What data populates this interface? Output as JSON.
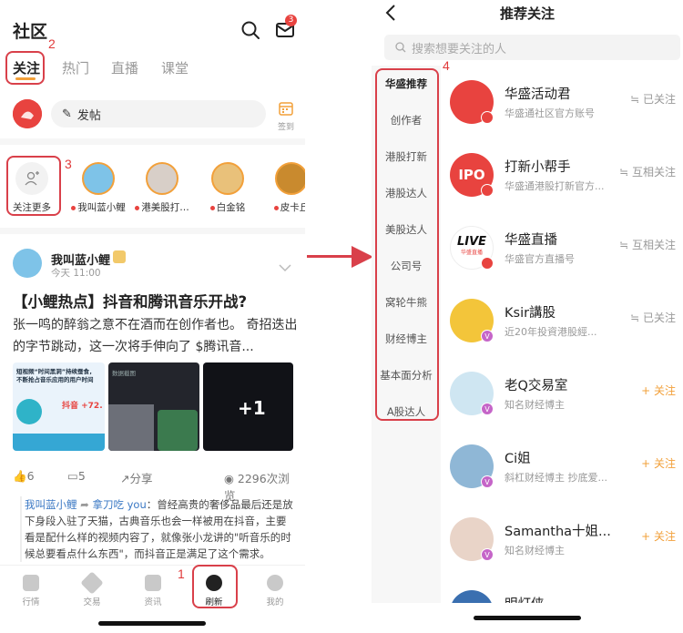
{
  "left": {
    "title": "社区",
    "mail_badge": "3",
    "tabs": [
      "关注",
      "热门",
      "直播",
      "课堂"
    ],
    "post_label": "发帖",
    "checkin_label": "签到",
    "follow_more": "关注更多",
    "followings": [
      {
        "name": "我叫蓝小鲤"
      },
      {
        "name": "港美股打…"
      },
      {
        "name": "白金铭"
      },
      {
        "name": "皮卡丘"
      }
    ],
    "post": {
      "author": "我叫蓝小鲤",
      "time": "今天 11:00",
      "headline": "【小鲤热点】抖音和腾讯音乐开战?",
      "excerpt": "张一鸣的醉翁之意不在酒而在创作者也。 奇招迭出的字节跳动，这一次将手伸向了 $腾讯音...",
      "images": [
        "短视频“时间黑洞”持续蚕食，不断抢占音乐应用的用户时间",
        "抖音 +72.",
        "数据截图",
        "+1"
      ],
      "likes": "6",
      "comments": "5",
      "share": "分享",
      "views": "2296次浏览",
      "comment_from": "我叫蓝小鲤",
      "comment_to": "拿刀吃 you",
      "comment_text": "：曾经高贵的奢侈品最后还是放下身段入驻了天猫，古典音乐也会一样被用在抖音，主要看是配什么样的视频内容了，就像张小龙讲的\"听音乐的时候总要看点什么东西\"，而抖音正是满足了这个需求。"
    },
    "nav": [
      "行情",
      "交易",
      "资讯",
      "刷新",
      "我的"
    ]
  },
  "annotations": [
    "1",
    "2",
    "3",
    "4"
  ],
  "right": {
    "title": "推荐关注",
    "search_placeholder": "搜索想要关注的人",
    "categories": [
      "华盛推荐",
      "创作者",
      "港股打新",
      "港股达人",
      "美股达人",
      "公司号",
      "窝轮牛熊",
      "财经博主",
      "基本面分析",
      "A股达人"
    ],
    "recs": [
      {
        "name": "华盛活动君",
        "desc": "华盛通社区官方账号",
        "btn": "≒ 已关注",
        "state": "followed"
      },
      {
        "name": "打新小帮手",
        "desc": "华盛通港股打新官方...",
        "btn": "≒ 互相关注",
        "state": "followed"
      },
      {
        "name": "华盛直播",
        "desc": "华盛官方直播号",
        "btn": "≒ 互相关注",
        "state": "followed"
      },
      {
        "name": "Ksir講股",
        "desc": "近20年投資港股經...",
        "btn": "≒ 已关注",
        "state": "followed"
      },
      {
        "name": "老Q交易室",
        "desc": "知名财经博主",
        "btn": "+ 关注",
        "state": "follow"
      },
      {
        "name": "Ci姐",
        "desc": "斜杠财经博主 抄底爱...",
        "btn": "+ 关注",
        "state": "follow"
      },
      {
        "name": "Samantha十姐...",
        "desc": "知名财经博主",
        "btn": "+ 关注",
        "state": "follow"
      },
      {
        "name": "明灯侠"
      }
    ],
    "avatar_text": {
      "ipo": "IPO",
      "live": "LIVE",
      "live_sub": "华盛直播"
    }
  },
  "colors": {
    "accent": "#f2a03a",
    "annotation": "#d9404a",
    "brand_red": "#e8433f"
  }
}
